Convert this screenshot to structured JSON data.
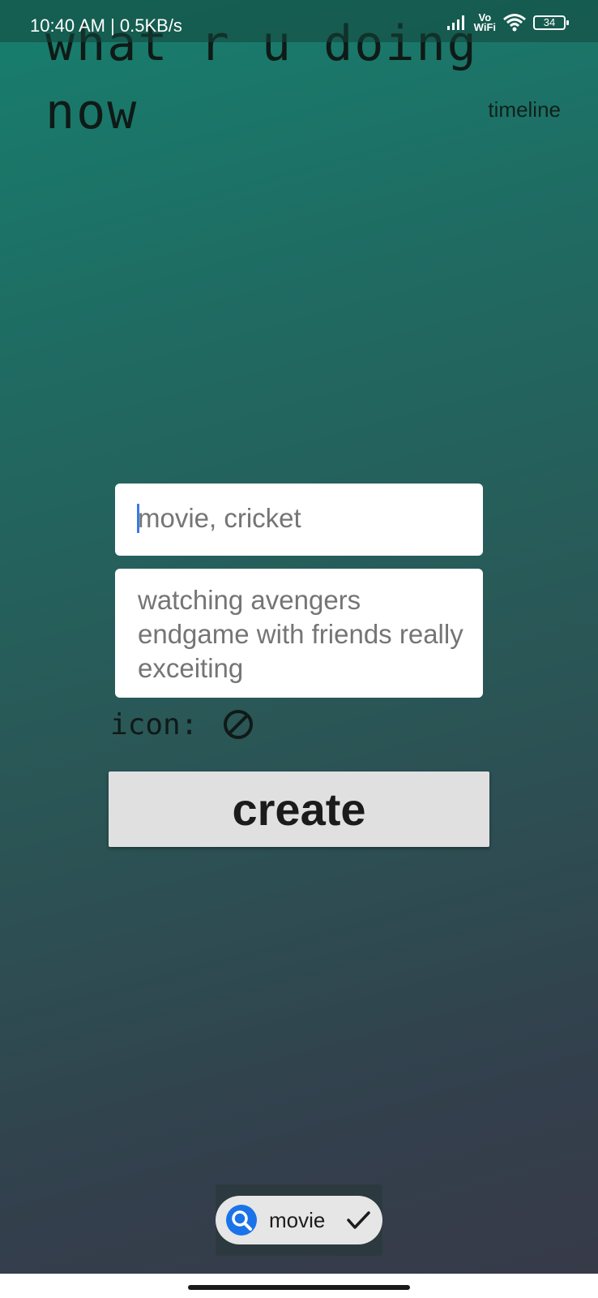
{
  "status_bar": {
    "time_and_speed": "10:40 AM | 0.5KB/s",
    "volte_top": "Vo",
    "volte_bottom": "WiFi",
    "battery": "34"
  },
  "header": {
    "headline": "what r u doing now",
    "timeline_link": "timeline"
  },
  "form": {
    "tags_placeholder": "movie, cricket",
    "description_text": "watching avengers endgame with friends really exceiting",
    "icon_label": "icon:",
    "icon_value": "none-icon",
    "create_label": "create"
  },
  "search_chip": {
    "text": "movie",
    "icon": "search-icon",
    "accent": "#1a73e8"
  },
  "colors": {
    "gradient_top": "#177f6e",
    "gradient_bottom": "#383a48",
    "button_bg": "#e0e0e0"
  }
}
